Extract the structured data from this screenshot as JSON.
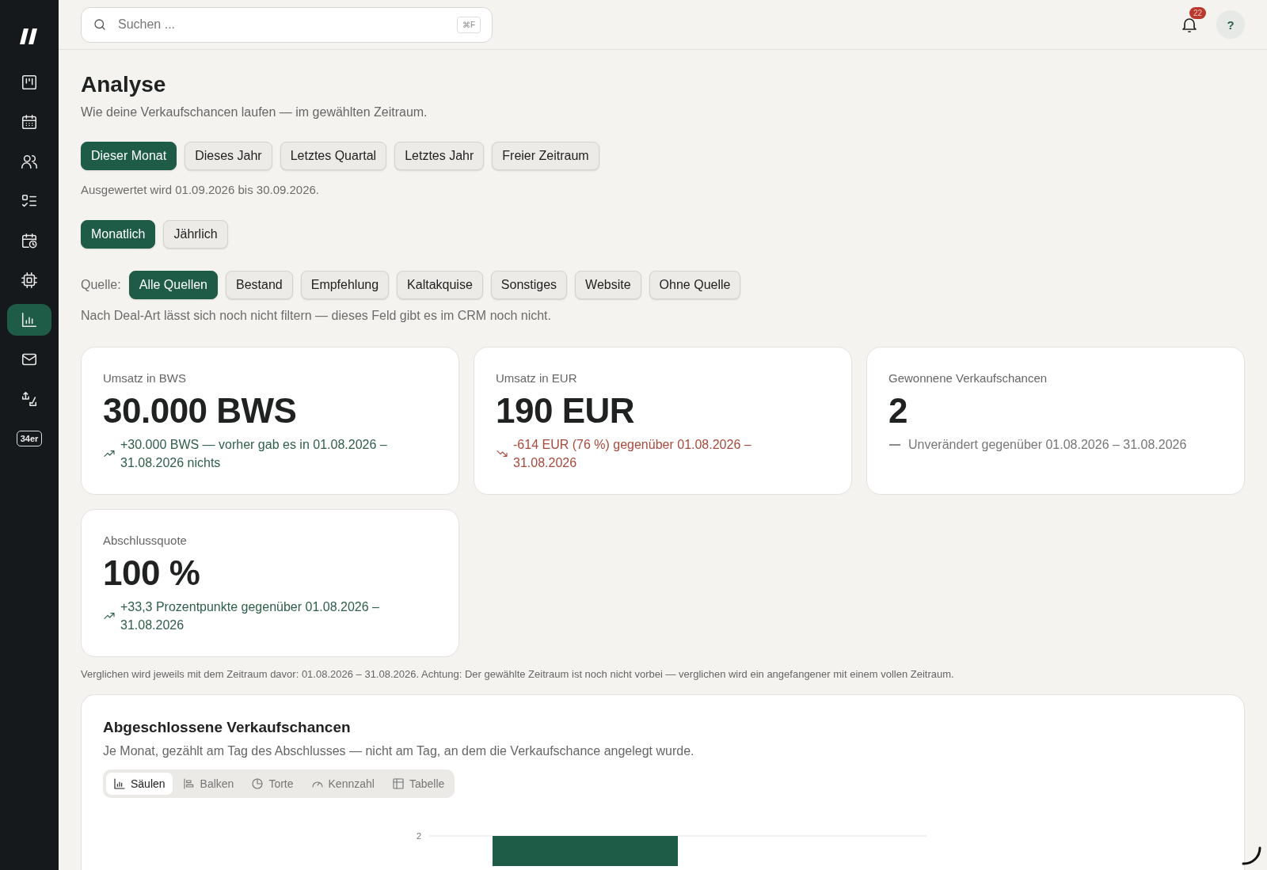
{
  "sidebar": {
    "items": [
      {
        "kind": "logo",
        "selected": false
      },
      {
        "kind": "board",
        "selected": false
      },
      {
        "kind": "calendar",
        "selected": false
      },
      {
        "kind": "users",
        "selected": false
      },
      {
        "kind": "checklist",
        "selected": false
      },
      {
        "kind": "schedule",
        "selected": false
      },
      {
        "kind": "chip",
        "selected": false
      },
      {
        "kind": "chart",
        "selected": true
      },
      {
        "kind": "mail",
        "selected": false
      },
      {
        "kind": "transfer",
        "selected": false
      },
      {
        "kind": "badge",
        "label": "34er",
        "selected": false
      }
    ]
  },
  "topbar": {
    "search": {
      "placeholder": "Suchen ...",
      "shortcut": "⌘F"
    },
    "notifications": {
      "count": "22"
    },
    "help": "?"
  },
  "page": {
    "title": "Analyse",
    "subtitle": "Wie deine Verkaufschancen laufen — im gewählten Zeitraum.",
    "periods": [
      {
        "label": "Dieser Monat",
        "selected": true
      },
      {
        "label": "Dieses Jahr",
        "selected": false
      },
      {
        "label": "Letztes Quartal",
        "selected": false
      },
      {
        "label": "Letztes Jahr",
        "selected": false
      },
      {
        "label": "Freier Zeitraum",
        "selected": false
      }
    ],
    "range_note": "Ausgewertet wird 01.09.2026 bis 30.09.2026.",
    "granularity": [
      {
        "label": "Monatlich",
        "selected": true
      },
      {
        "label": "Jährlich",
        "selected": false
      }
    ],
    "source_label": "Quelle:",
    "sources": [
      {
        "label": "Alle Quellen",
        "selected": true
      },
      {
        "label": "Bestand",
        "selected": false
      },
      {
        "label": "Empfehlung",
        "selected": false
      },
      {
        "label": "Kaltakquise",
        "selected": false
      },
      {
        "label": "Sonstiges",
        "selected": false
      },
      {
        "label": "Website",
        "selected": false
      },
      {
        "label": "Ohne Quelle",
        "selected": false
      }
    ],
    "filter_note": "Nach Deal-Art lässt sich noch nicht filtern — dieses Feld gibt es im CRM noch nicht.",
    "kpis": [
      {
        "label": "Umsatz in BWS",
        "value": "30.000 BWS",
        "kind": "up",
        "change": "+30.000 BWS — vorher gab es in 01.08.2026 – 31.08.2026 nichts"
      },
      {
        "label": "Umsatz in EUR",
        "value": "190 EUR",
        "kind": "down",
        "change": "-614 EUR (76 %) gegenüber 01.08.2026 – 31.08.2026"
      },
      {
        "label": "Gewonnene Verkaufschancen",
        "value": "2",
        "kind": "flat",
        "change": "Unverändert gegenüber 01.08.2026 – 31.08.2026"
      },
      {
        "label": "Abschlussquote",
        "value": "100 %",
        "kind": "up",
        "change": "+33,3 Prozentpunkte gegenüber 01.08.2026 – 31.08.2026"
      }
    ],
    "compare_note": "Verglichen wird jeweils mit dem Zeitraum davor: 01.08.2026 – 31.08.2026. Achtung: Der gewählte Zeitraum ist noch nicht vorbei — verglichen wird ein angefangener mit einem vollen Zeitraum.",
    "chart_card": {
      "title": "Abgeschlossene Verkaufschancen",
      "subtitle": "Je Monat, gezählt am Tag des Abschlusses — nicht am Tag, an dem die Verkaufschance angelegt wurde.",
      "views": [
        {
          "kind": "columns",
          "label": "Säulen",
          "selected": true
        },
        {
          "kind": "bars",
          "label": "Balken",
          "selected": false
        },
        {
          "kind": "pie",
          "label": "Torte",
          "selected": false
        },
        {
          "kind": "gauge",
          "label": "Kennzahl",
          "selected": false
        },
        {
          "kind": "table",
          "label": "Tabelle",
          "selected": false
        }
      ],
      "y_tick_label": "2"
    }
  }
}
